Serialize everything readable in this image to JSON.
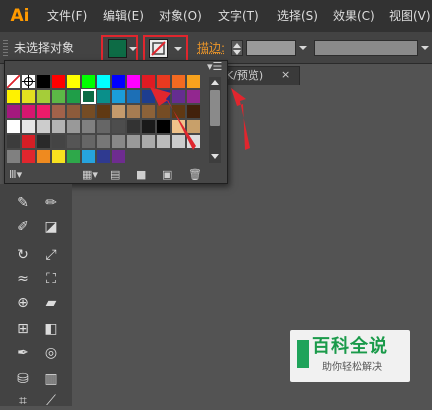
{
  "app": {
    "logo": "Ai"
  },
  "menu": {
    "items": [
      "文件(F)",
      "编辑(E)",
      "对象(O)",
      "文字(T)",
      "选择(S)",
      "效果(C)",
      "视图(V)"
    ]
  },
  "control_bar": {
    "selection_label": "未选择对象",
    "fill_color": "#0d6b45",
    "stroke_label": "描边:",
    "stroke_none_color": "#e0262e",
    "highlight_color": "#e0262e"
  },
  "document_tab": {
    "label": "K/预览)",
    "close": "×"
  },
  "swatch_panel": {
    "rows": [
      [
        "#ffffff",
        "#ffffff",
        "#000000",
        "#ff0000",
        "#ffff00",
        "#00ff00",
        "#00ffff",
        "#0000ff",
        "#ff00ff",
        "#e01b23",
        "#e83a20",
        "#f26a21",
        "#f7a21d"
      ],
      [
        "#fff200",
        "#e3e020",
        "#a5cd39",
        "#5cb846",
        "#1f9e48",
        "#0d6b45",
        "#0a8f8a",
        "#1b9dd9",
        "#1c6fb6",
        "#1d3d8f",
        "#2c2f86",
        "#652d90",
        "#92278f"
      ],
      [
        "#a4187e",
        "#d6166f",
        "#ed1b6a",
        "#a2624a",
        "#8d5b3b",
        "#754c24",
        "#603913",
        "#c49a6c",
        "#a67c52",
        "#8c6239",
        "#754c24",
        "#603813",
        "#42210b"
      ],
      [
        "#ffffff",
        "#e6e6e6",
        "#cccccc",
        "#b3b3b3",
        "#999999",
        "#808080",
        "#666666",
        "#4d4d4d",
        "#333333",
        "#1a1a1a",
        "#000000",
        "#f0c28a",
        "#c8a06a"
      ],
      [
        "#3c3c3c",
        "#d41e25",
        "#2a2a2a",
        "#444444",
        "#555555",
        "#666666",
        "#777777",
        "#888888",
        "#999999",
        "#aaaaaa",
        "#bbbbbb",
        "#cccccc",
        "#dddddd"
      ],
      [
        "#808080",
        "#e0262e",
        "#ef8a1f",
        "#f7e11f",
        "#2ea84a",
        "#26a3dd",
        "#2f3a90",
        "#6e2c8f",
        "#474747",
        "#474747",
        "#474747",
        "#474747",
        "#474747"
      ]
    ],
    "selected_color": "#0d6b45"
  },
  "arrow_color": "#e0262e",
  "watermark": {
    "title": "百科全说",
    "subtitle": "助你轻松解决"
  }
}
